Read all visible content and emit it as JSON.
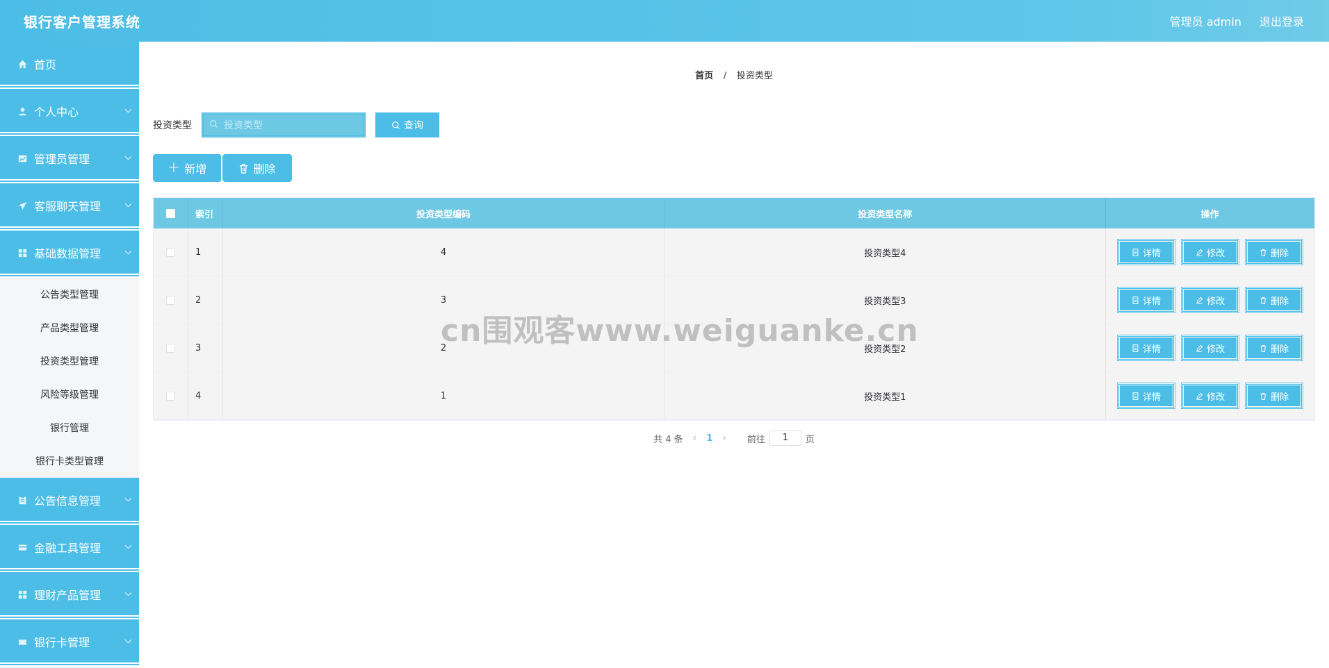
{
  "header": {
    "title": "银行客户管理系统",
    "user": "管理员 admin",
    "logout": "退出登录"
  },
  "sidebar": {
    "items_top": [
      {
        "label": "首页",
        "icon": "home-icon"
      },
      {
        "label": "个人中心",
        "icon": "user-icon"
      },
      {
        "label": "管理员管理",
        "icon": "chart-icon"
      },
      {
        "label": "客服聊天管理",
        "icon": "send-icon"
      },
      {
        "label": "基础数据管理",
        "icon": "grid-icon"
      }
    ],
    "submenu": [
      "公告类型管理",
      "产品类型管理",
      "投资类型管理",
      "风险等级管理",
      "银行管理",
      "银行卡类型管理"
    ],
    "items_bottom": [
      {
        "label": "公告信息管理",
        "icon": "clipboard-icon"
      },
      {
        "label": "金融工具管理",
        "icon": "card-icon"
      },
      {
        "label": "理财产品管理",
        "icon": "grid-icon"
      },
      {
        "label": "银行卡管理",
        "icon": "ticket-icon"
      }
    ]
  },
  "breadcrumb": {
    "home": "首页",
    "sep": "/",
    "current": "投资类型"
  },
  "search": {
    "label": "投资类型",
    "placeholder": "投资类型",
    "button": "查询"
  },
  "actions": {
    "add": "新增",
    "delete": "删除"
  },
  "table": {
    "headers": {
      "index": "索引",
      "code": "投资类型编码",
      "name": "投资类型名称",
      "ops": "操作"
    },
    "rows": [
      {
        "index": "1",
        "code": "4",
        "name": "投资类型4"
      },
      {
        "index": "2",
        "code": "3",
        "name": "投资类型3"
      },
      {
        "index": "3",
        "code": "2",
        "name": "投资类型2"
      },
      {
        "index": "4",
        "code": "1",
        "name": "投资类型1"
      }
    ],
    "op_labels": {
      "detail": "详情",
      "edit": "修改",
      "delete": "删除"
    }
  },
  "pagination": {
    "total": "共 4 条",
    "current_page": "1",
    "goto_label": "前往",
    "goto_value": "1",
    "page_suffix": "页"
  },
  "watermark": "cn围观客www.weiguanke.cn",
  "colors": {
    "primary": "#4bbde6",
    "table_head": "#6ec8e4",
    "row_bg": "#f4f4f5"
  }
}
